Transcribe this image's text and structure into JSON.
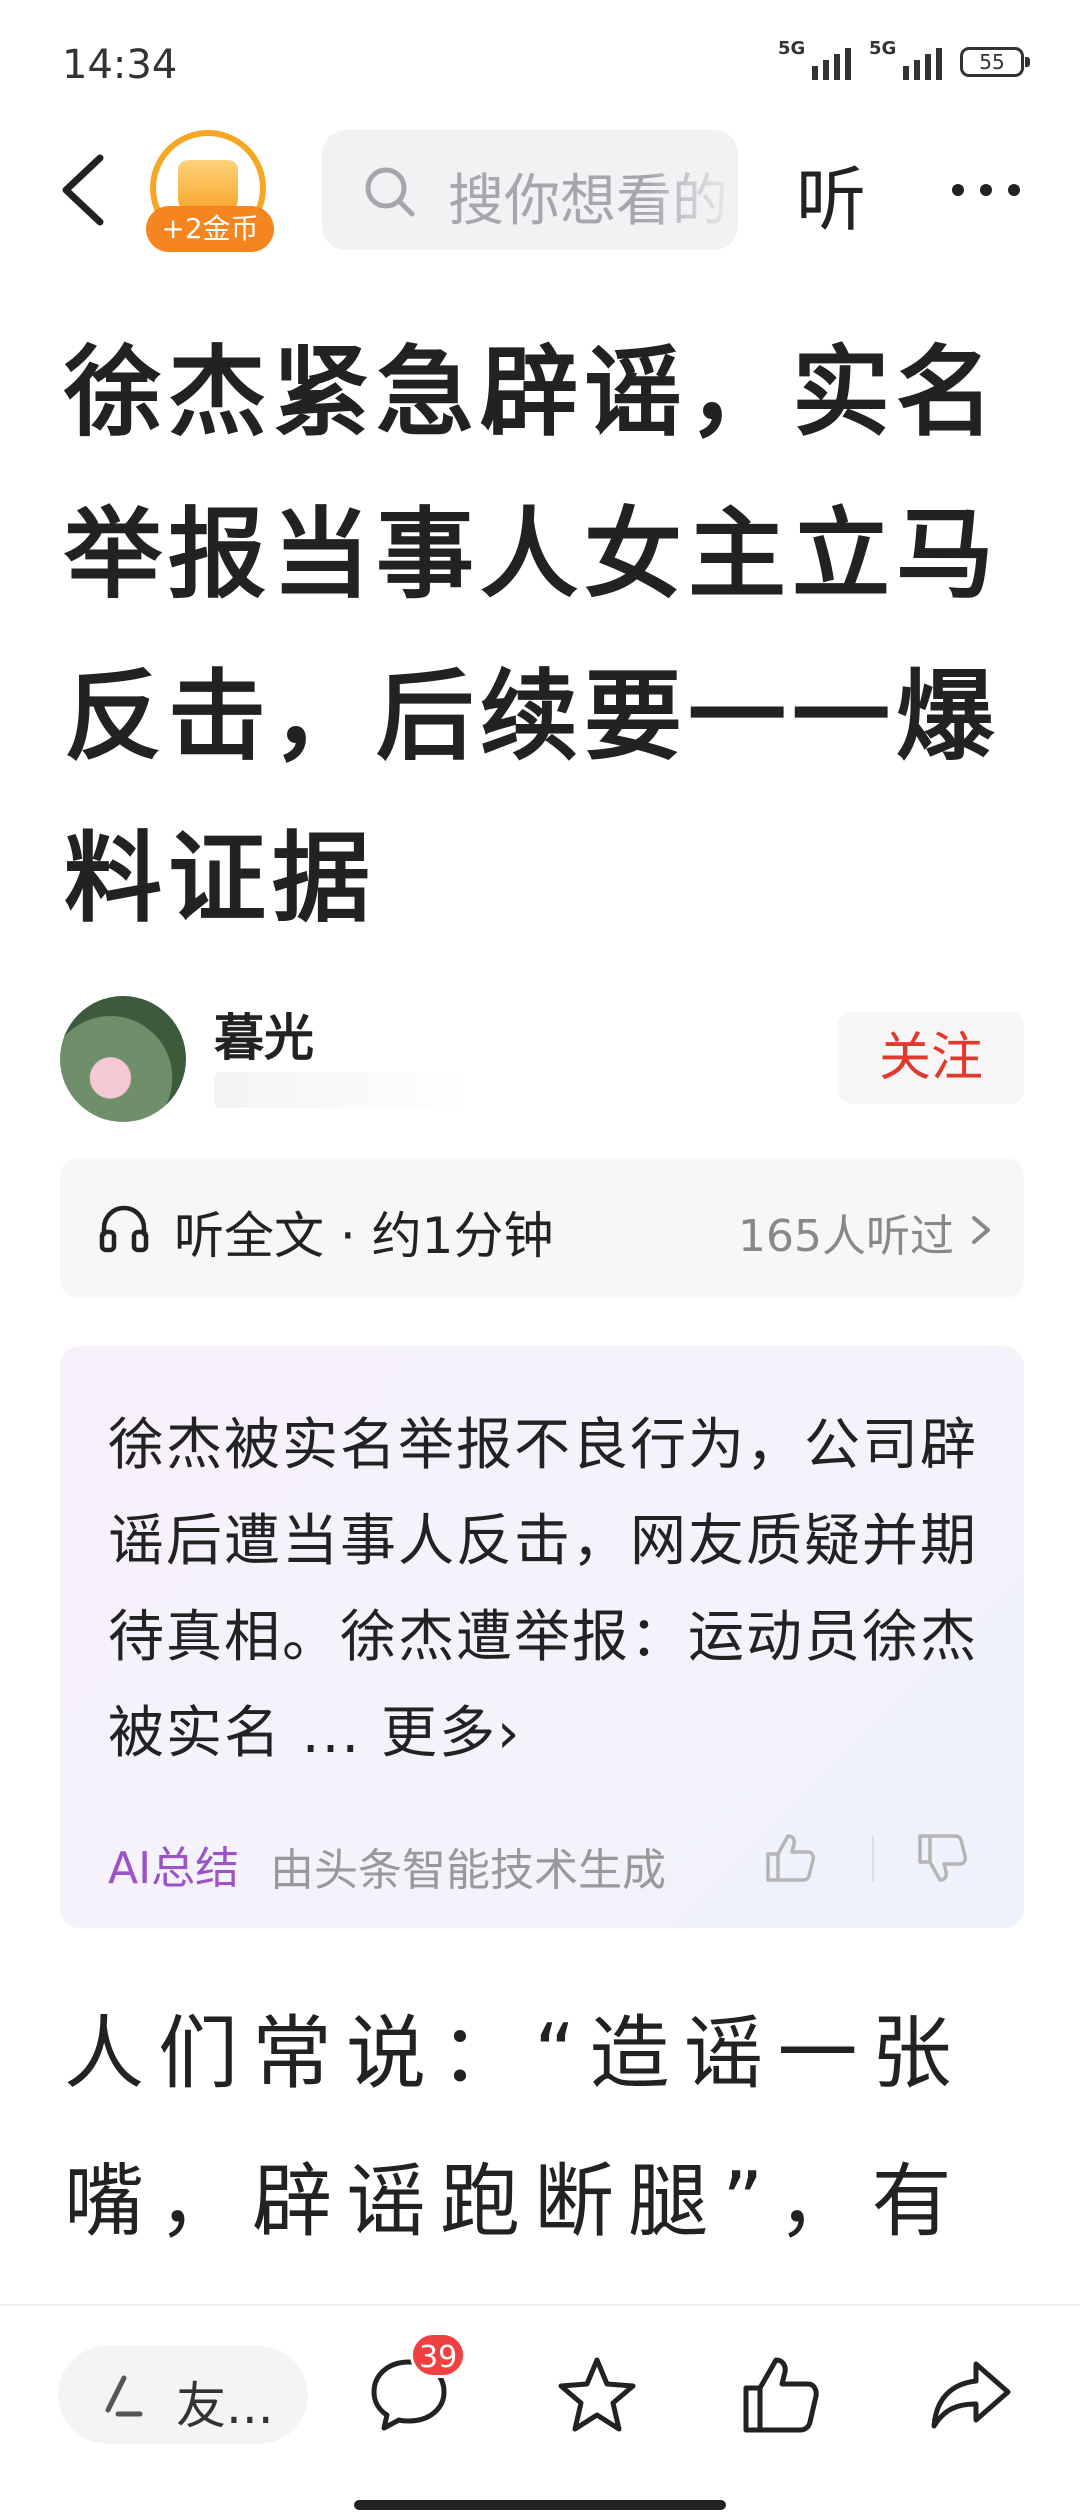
{
  "status_bar": {
    "time": "14:34",
    "signal_1_label": "5G",
    "signal_2_label": "5G",
    "battery": "55"
  },
  "nav": {
    "coin_reward": "+2金币",
    "search_placeholder": "搜你想看的",
    "listen_label": "听",
    "back_icon": "chevron-left-icon",
    "more_icon": "more-dots-icon"
  },
  "article": {
    "title": "徐杰紧急辟谣，实名举报当事人女主立马反击，后续要一一爆料证据",
    "author_name": "暮光",
    "follow_label": "关注"
  },
  "listen_bar": {
    "title": "听全文 · 约1分钟",
    "count": "165人听过"
  },
  "ai_summary": {
    "text": "徐杰被实名举报不良行为，公司辟谣后遭当事人反击，网友质疑并期待真相。徐杰遭举报：运动员徐杰被实名 ...",
    "more_label": "更多",
    "tag": "AI总结",
    "source": "由头条智能技术生成"
  },
  "body": {
    "text": "人们常说：“造谣一张嘴，辟谣跑断腿”，有网"
  },
  "bottom_bar": {
    "comment_placeholder": "友...",
    "comment_count": "39"
  },
  "colors": {
    "accent_red": "#e03a2f",
    "coin_orange": "#f5851f",
    "ai_purple": "#9a54c8",
    "badge_red": "#f04040"
  }
}
